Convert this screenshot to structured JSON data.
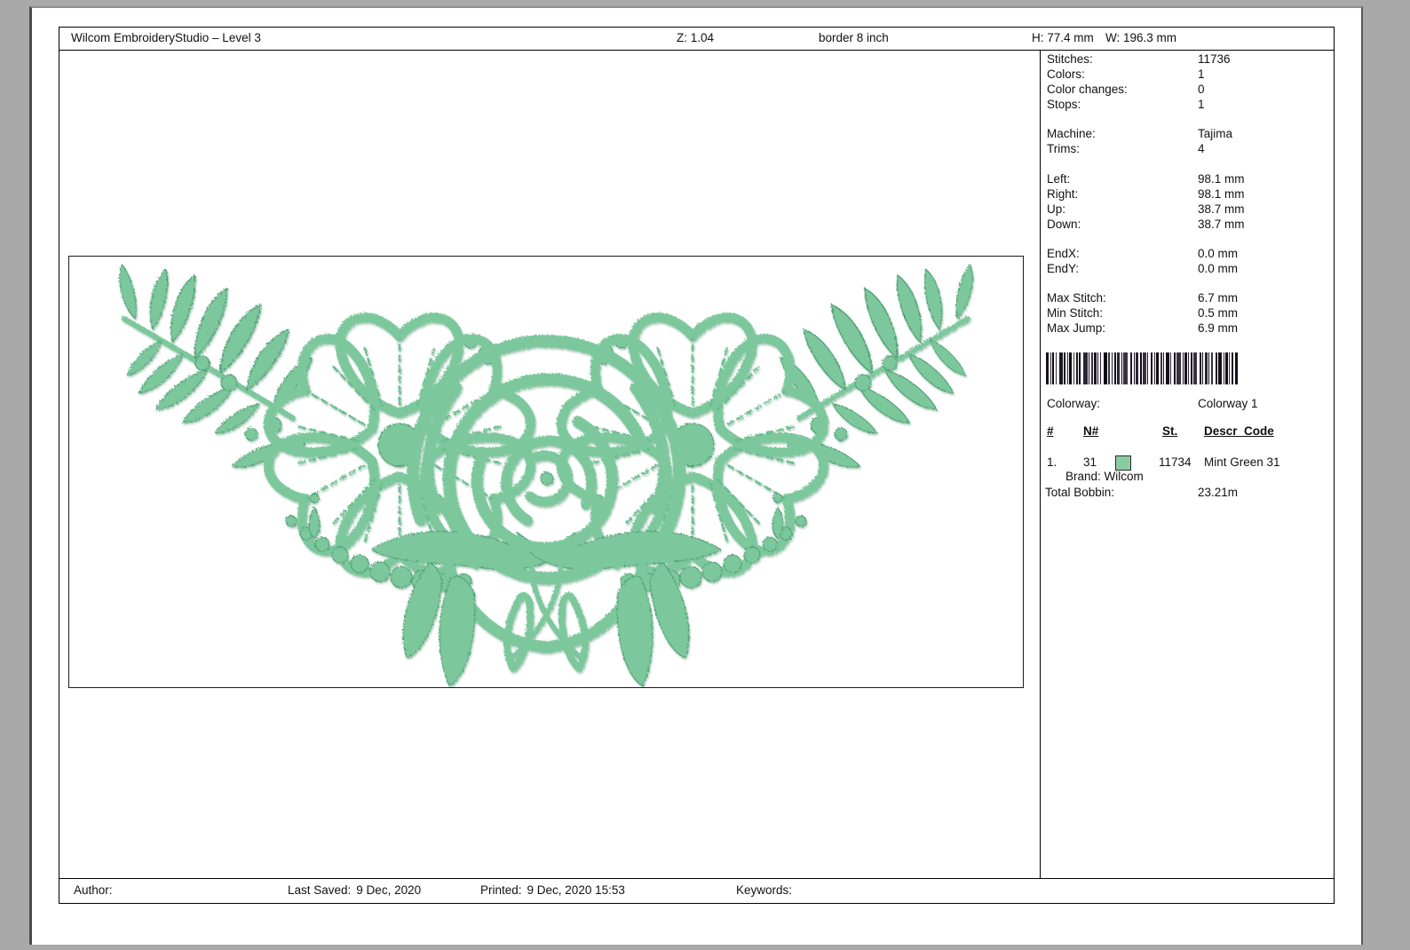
{
  "header": {
    "title": "Wilcom EmbroideryStudio – Level 3",
    "zoom_label": "Z: 1.04",
    "design_name": "border 8 inch",
    "height_label": "H: 77.4 mm",
    "width_label": "W: 196.3 mm"
  },
  "design": {
    "description": "mint green floral embroidery border: central rose, two petunia flowers, fern sprays, bead chains and leaves",
    "thread_color": "#7cc89c",
    "thread_color_mid": "#6bbd8f",
    "thread_color_dark": "#4d9e72"
  },
  "stats": {
    "groups": [
      [
        {
          "label": "Stitches:",
          "value": "11736"
        },
        {
          "label": "Colors:",
          "value": "1"
        },
        {
          "label": "Color changes:",
          "value": "0"
        },
        {
          "label": "Stops:",
          "value": "1"
        }
      ],
      [
        {
          "label": "Machine:",
          "value": "Tajima"
        },
        {
          "label": "Trims:",
          "value": "4"
        }
      ],
      [
        {
          "label": "Left:",
          "value": "98.1 mm"
        },
        {
          "label": "Right:",
          "value": "98.1 mm"
        },
        {
          "label": "Up:",
          "value": "38.7 mm"
        },
        {
          "label": "Down:",
          "value": "38.7 mm"
        }
      ],
      [
        {
          "label": "EndX:",
          "value": "0.0 mm"
        },
        {
          "label": "EndY:",
          "value": "0.0 mm"
        }
      ],
      [
        {
          "label": "Max Stitch:",
          "value": "6.7 mm"
        },
        {
          "label": "Min Stitch:",
          "value": "0.5 mm"
        },
        {
          "label": "Max Jump:",
          "value": "6.9 mm"
        }
      ]
    ]
  },
  "colorway": {
    "label": "Colorway:",
    "value": "Colorway 1"
  },
  "thread_table": {
    "headers": {
      "index": "#",
      "n": "N#",
      "st": "St.",
      "descr": "Descr_Code"
    },
    "rows": [
      {
        "index": "1.",
        "n": "31",
        "swatch": "#8bcba4",
        "st": "11734",
        "descr": "Mint Green 31"
      }
    ],
    "brand": "Brand: Wilcom",
    "total_label": "Total Bobbin:",
    "total_value": "23.21m"
  },
  "footer": {
    "author_label": "Author:",
    "author_value": "",
    "saved_label": "Last Saved:",
    "saved_value": "9 Dec, 2020",
    "printed_label": "Printed:",
    "printed_value": "9 Dec, 2020 15:53",
    "keywords_label": "Keywords:",
    "keywords_value": ""
  }
}
